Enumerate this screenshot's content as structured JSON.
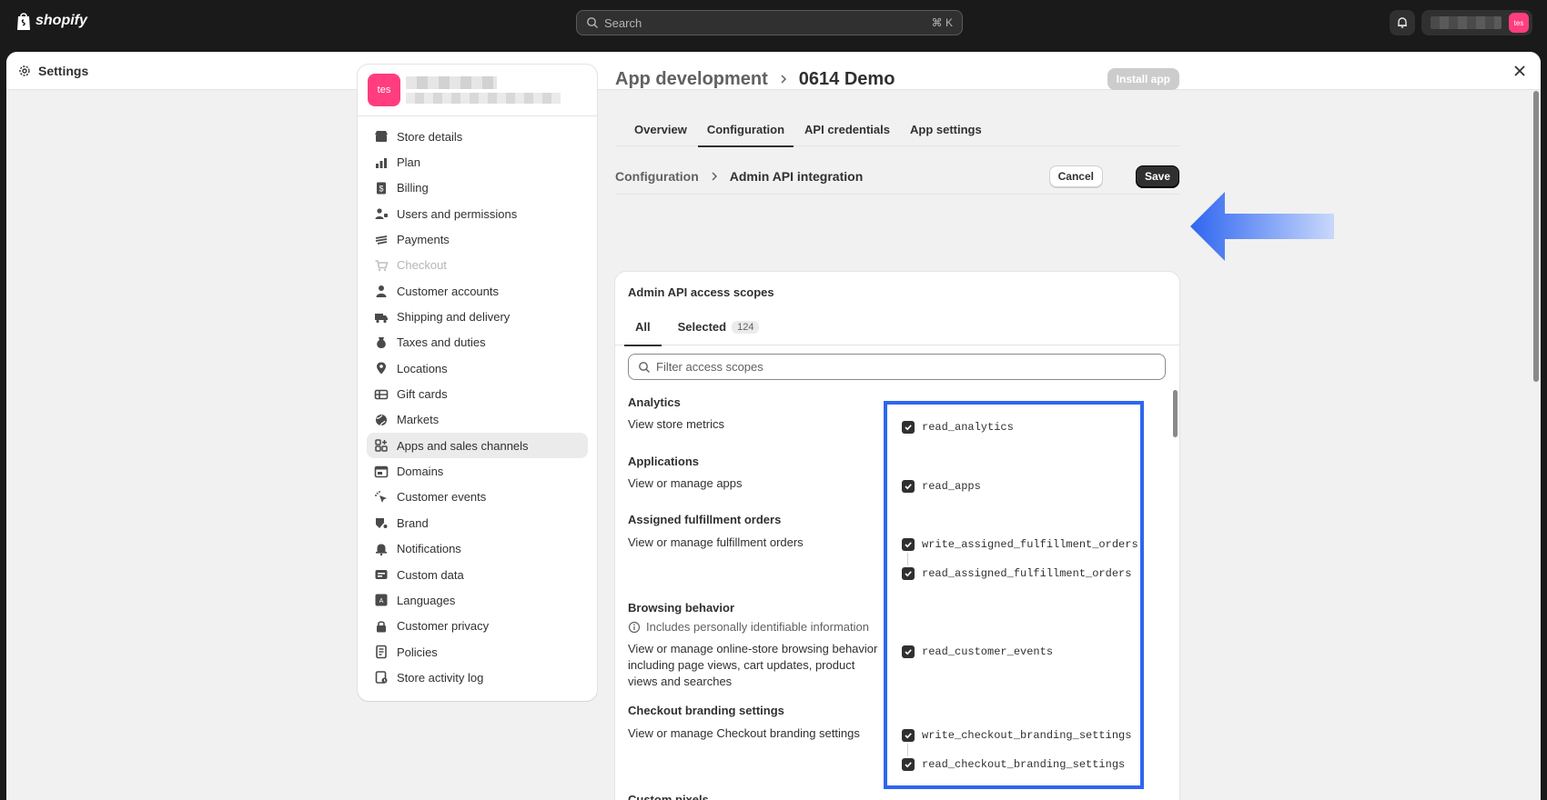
{
  "topbar": {
    "logo_text": "shopify",
    "search_placeholder": "Search",
    "search_shortcut": "⌘ K",
    "account_avatar": "tes"
  },
  "modal": {
    "title": "Settings"
  },
  "store": {
    "avatar_text": "tes"
  },
  "nav": {
    "items": [
      {
        "label": "Store details",
        "icon": "store-icon"
      },
      {
        "label": "Plan",
        "icon": "plan-icon"
      },
      {
        "label": "Billing",
        "icon": "billing-icon"
      },
      {
        "label": "Users and permissions",
        "icon": "users-icon"
      },
      {
        "label": "Payments",
        "icon": "payments-icon"
      },
      {
        "label": "Checkout",
        "icon": "cart-icon"
      },
      {
        "label": "Customer accounts",
        "icon": "person-icon"
      },
      {
        "label": "Shipping and delivery",
        "icon": "truck-icon"
      },
      {
        "label": "Taxes and duties",
        "icon": "taxes-icon"
      },
      {
        "label": "Locations",
        "icon": "location-icon"
      },
      {
        "label": "Gift cards",
        "icon": "gift-card-icon"
      },
      {
        "label": "Markets",
        "icon": "globe-icon"
      },
      {
        "label": "Apps and sales channels",
        "icon": "apps-icon"
      },
      {
        "label": "Domains",
        "icon": "domain-icon"
      },
      {
        "label": "Customer events",
        "icon": "cursor-icon"
      },
      {
        "label": "Brand",
        "icon": "brand-icon"
      },
      {
        "label": "Notifications",
        "icon": "bell-icon"
      },
      {
        "label": "Custom data",
        "icon": "data-icon"
      },
      {
        "label": "Languages",
        "icon": "language-icon"
      },
      {
        "label": "Customer privacy",
        "icon": "lock-icon"
      },
      {
        "label": "Policies",
        "icon": "policy-icon"
      },
      {
        "label": "Store activity log",
        "icon": "activity-icon"
      }
    ]
  },
  "header": {
    "parent": "App development",
    "current": "0614 Demo",
    "install_label": "Install app"
  },
  "tabs": [
    "Overview",
    "Configuration",
    "API credentials",
    "App settings"
  ],
  "subheader": {
    "parent": "Configuration",
    "current": "Admin API integration",
    "cancel_label": "Cancel",
    "save_label": "Save"
  },
  "scopes": {
    "title": "Admin API access scopes",
    "tab_all": "All",
    "tab_selected": "Selected",
    "selected_count": "124",
    "filter_placeholder": "Filter access scopes",
    "groups": [
      {
        "title": "Analytics",
        "desc": "View store metrics",
        "scopes": [
          "read_analytics"
        ]
      },
      {
        "title": "Applications",
        "desc": "View or manage apps",
        "scopes": [
          "read_apps"
        ]
      },
      {
        "title": "Assigned fulfillment orders",
        "desc": "View or manage fulfillment orders",
        "scopes": [
          "write_assigned_fulfillment_orders",
          "read_assigned_fulfillment_orders"
        ]
      },
      {
        "title": "Browsing behavior",
        "note": "Includes personally identifiable information",
        "desc": "View or manage online-store browsing behavior including page views, cart updates, product views and searches",
        "scopes": [
          "read_customer_events"
        ]
      },
      {
        "title": "Checkout branding settings",
        "desc": "View or manage Checkout branding settings",
        "scopes": [
          "write_checkout_branding_settings",
          "read_checkout_branding_settings"
        ]
      },
      {
        "title": "Custom pixels",
        "desc": "",
        "scopes": []
      }
    ]
  },
  "colors": {
    "accent_blue": "#2f66f0",
    "avatar_pink": "#ff3d7f",
    "topbar_bg": "#1a1a1a"
  }
}
